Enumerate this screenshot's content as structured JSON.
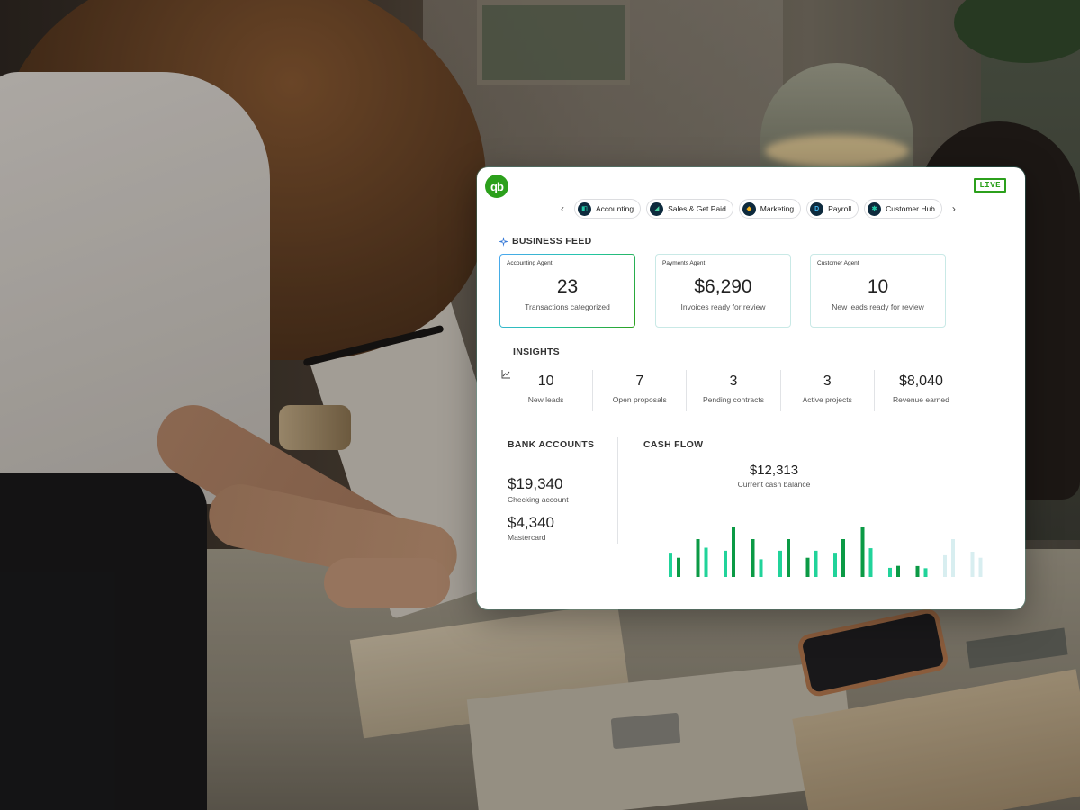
{
  "header": {
    "logo_text": "qb",
    "live_badge": "LIVE"
  },
  "tabs": [
    {
      "label": "Accounting",
      "icon": "accounting-icon",
      "glyph": "◧",
      "color": "#0d2a3d",
      "glyph_color": "#22c7a6"
    },
    {
      "label": "Sales & Get Paid",
      "icon": "sales-icon",
      "glyph": "◢",
      "color": "#0d2a3d",
      "glyph_color": "#4ad0a0"
    },
    {
      "label": "Marketing",
      "icon": "marketing-icon",
      "glyph": "◆",
      "color": "#0d2a3d",
      "glyph_color": "#f5b21b"
    },
    {
      "label": "Payroll",
      "icon": "payroll-icon",
      "glyph": "D",
      "color": "#0d2a3d",
      "glyph_color": "#41b6f0"
    },
    {
      "label": "Customer Hub",
      "icon": "customer-hub-icon",
      "glyph": "✱",
      "color": "#0d2a3d",
      "glyph_color": "#22c7a6"
    }
  ],
  "business_feed": {
    "title": "BUSINESS FEED",
    "cards": [
      {
        "agent": "Accounting Agent",
        "value": "23",
        "desc": "Transactions categorized"
      },
      {
        "agent": "Payments Agent",
        "value": "$6,290",
        "desc": "Invoices ready for review"
      },
      {
        "agent": "Customer Agent",
        "value": "10",
        "desc": "New leads ready for review"
      }
    ]
  },
  "insights": {
    "title": "INSIGHTS",
    "items": [
      {
        "value": "10",
        "label": "New leads"
      },
      {
        "value": "7",
        "label": "Open proposals"
      },
      {
        "value": "3",
        "label": "Pending contracts"
      },
      {
        "value": "3",
        "label": "Active projects"
      },
      {
        "value": "$8,040",
        "label": "Revenue earned"
      }
    ]
  },
  "bank_accounts": {
    "title": "BANK ACCOUNTS",
    "accounts": [
      {
        "amount": "$19,340",
        "label": "Checking account"
      },
      {
        "amount": "$4,340",
        "label": "Mastercard"
      }
    ]
  },
  "cash_flow": {
    "title": "CASH FLOW",
    "value": "$12,313",
    "label": "Current cash balance"
  },
  "colors": {
    "brand_green": "#2ca01c",
    "bar_dark": "#0b9a45",
    "bar_light": "#21d39a",
    "bar_faded": "#d8eef0"
  },
  "chart_data": {
    "type": "bar",
    "series": [
      {
        "values": [
          0.38,
          0.75,
          1.0,
          0.75,
          0.75,
          0.38,
          0.75,
          1.0,
          0.22,
          0.72,
          0.75,
          0.5
        ]
      },
      {
        "values": [
          0.48,
          0.58,
          0.52,
          0.35,
          0.52,
          0.52,
          0.48,
          0.57,
          0.18,
          0.43,
          0.43,
          0.38
        ]
      }
    ],
    "faded_from_index": 9
  }
}
